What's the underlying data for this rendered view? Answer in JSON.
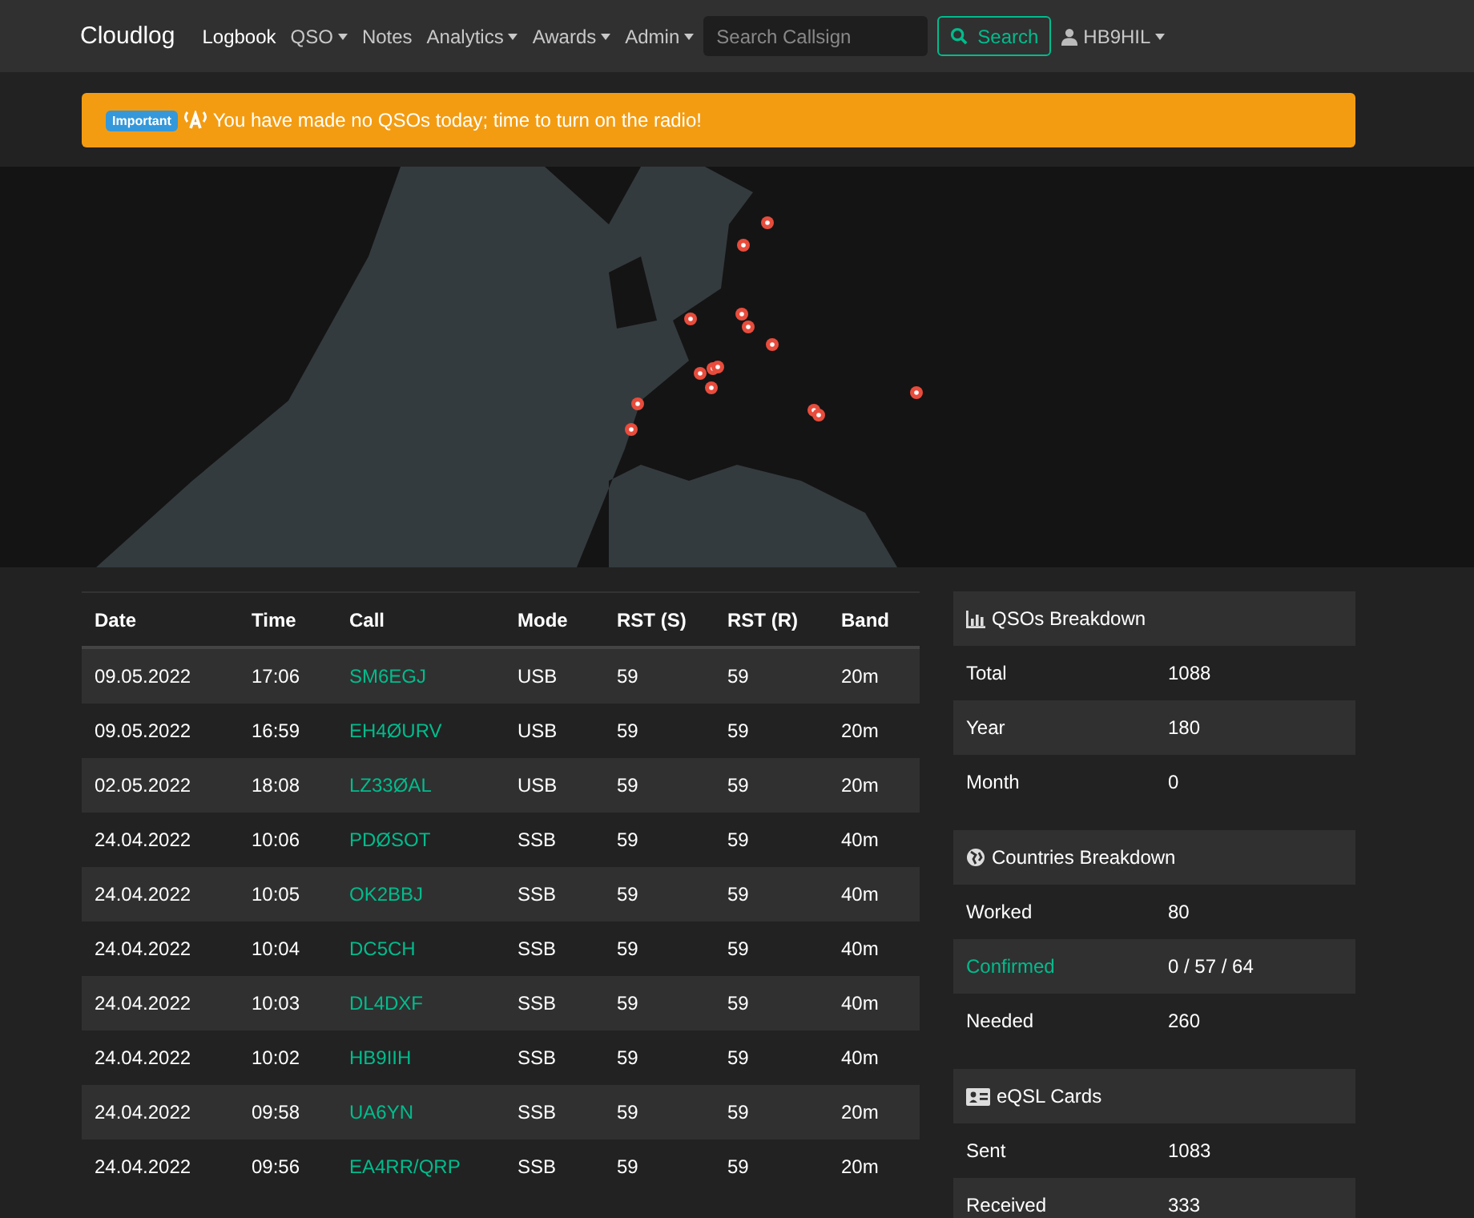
{
  "navbar": {
    "brand": "Cloudlog",
    "items": [
      {
        "label": "Logbook",
        "dropdown": false,
        "selected": true
      },
      {
        "label": "QSO",
        "dropdown": true,
        "selected": false
      },
      {
        "label": "Notes",
        "dropdown": false,
        "selected": false
      },
      {
        "label": "Analytics",
        "dropdown": true,
        "selected": false
      },
      {
        "label": "Awards",
        "dropdown": true,
        "selected": false
      },
      {
        "label": "Admin",
        "dropdown": true,
        "selected": false
      }
    ],
    "search": {
      "placeholder": "Search Callsign"
    },
    "search_button": "Search",
    "user": "HB9HIL"
  },
  "alert": {
    "badge": "Important",
    "message": "You have made no QSOs today; time to turn on the radio!"
  },
  "table": {
    "columns": [
      "Date",
      "Time",
      "Call",
      "Mode",
      "RST (S)",
      "RST (R)",
      "Band"
    ],
    "rows": [
      [
        "09.05.2022",
        "17:06",
        "SM6EGJ",
        "USB",
        "59",
        "59",
        "20m"
      ],
      [
        "09.05.2022",
        "16:59",
        "EH4ØURV",
        "USB",
        "59",
        "59",
        "20m"
      ],
      [
        "02.05.2022",
        "18:08",
        "LZ33ØAL",
        "USB",
        "59",
        "59",
        "20m"
      ],
      [
        "24.04.2022",
        "10:06",
        "PDØSOT",
        "SSB",
        "59",
        "59",
        "40m"
      ],
      [
        "24.04.2022",
        "10:05",
        "OK2BBJ",
        "SSB",
        "59",
        "59",
        "40m"
      ],
      [
        "24.04.2022",
        "10:04",
        "DC5CH",
        "SSB",
        "59",
        "59",
        "40m"
      ],
      [
        "24.04.2022",
        "10:03",
        "DL4DXF",
        "SSB",
        "59",
        "59",
        "40m"
      ],
      [
        "24.04.2022",
        "10:02",
        "HB9IIH",
        "SSB",
        "59",
        "59",
        "40m"
      ],
      [
        "24.04.2022",
        "09:58",
        "UA6YN",
        "SSB",
        "59",
        "59",
        "20m"
      ],
      [
        "24.04.2022",
        "09:56",
        "EA4RR/QRP",
        "SSB",
        "59",
        "59",
        "20m"
      ]
    ]
  },
  "panels": [
    {
      "kind": "chart",
      "title": "QSOs Breakdown",
      "rows": [
        {
          "label": "Total",
          "value": "1088",
          "link": false
        },
        {
          "label": "Year",
          "value": "180",
          "link": false
        },
        {
          "label": "Month",
          "value": "0",
          "link": false
        }
      ]
    },
    {
      "kind": "globe",
      "title": "Countries Breakdown",
      "rows": [
        {
          "label": "Worked",
          "value": "80",
          "link": false
        },
        {
          "label": "Confirmed",
          "value": "0 / 57 / 64",
          "link": true
        },
        {
          "label": "Needed",
          "value": "260",
          "link": false
        }
      ]
    },
    {
      "kind": "card",
      "title": "eQSL Cards",
      "rows": [
        {
          "label": "Sent",
          "value": "1083",
          "link": false
        },
        {
          "label": "Received",
          "value": "333",
          "link": false
        }
      ]
    }
  ]
}
